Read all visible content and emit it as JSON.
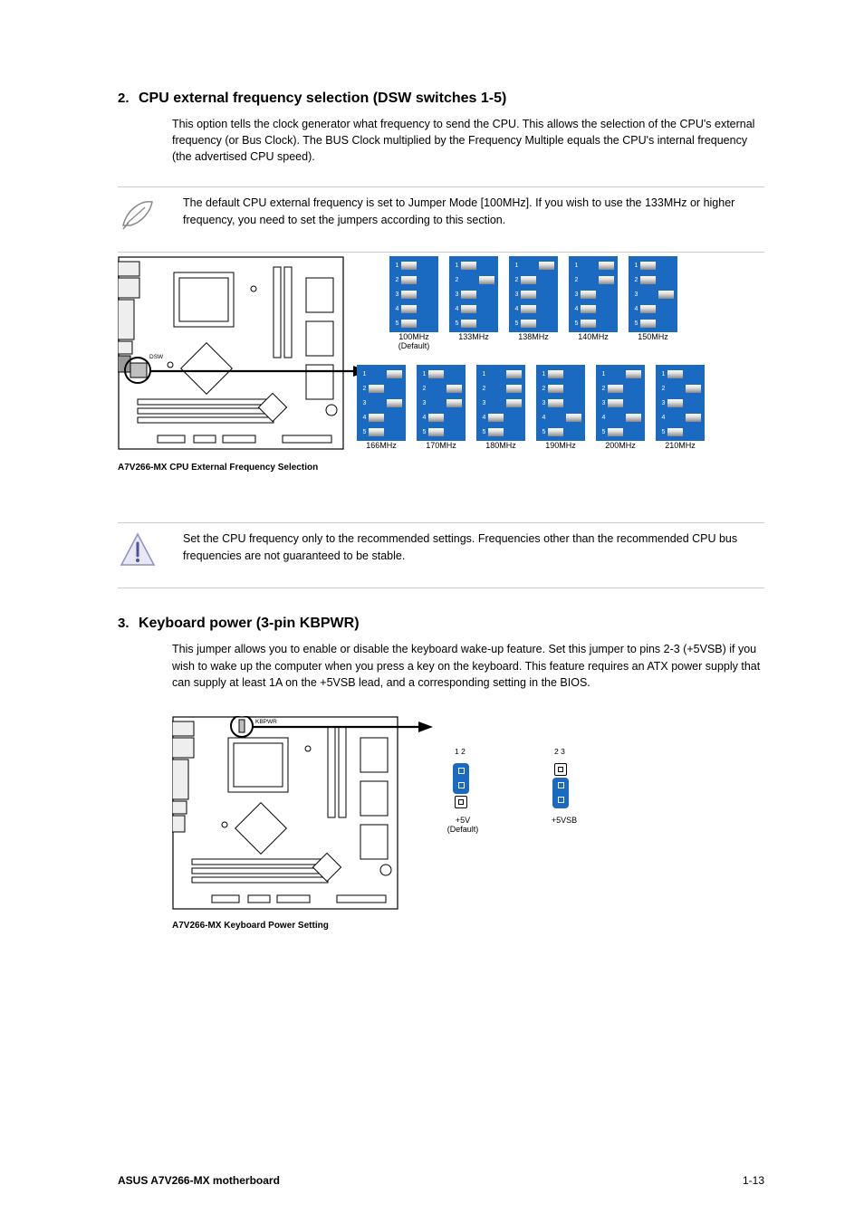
{
  "section1": {
    "num": "2.",
    "title": "CPU external frequency selection (DSW switches 1-5)",
    "para": "This option tells the clock generator what frequency to send the CPU. This allows the selection of the CPU's external frequency (or Bus Clock). The BUS Clock multiplied by the Frequency Multiple equals the CPU's internal frequency (the advertised CPU speed).",
    "note": "The default CPU external frequency is set to Jumper Mode [100MHz]. If you wish to use the 133MHz or higher frequency, you need to set the jumpers according to this section.",
    "caption": "A7V266-MX CPU External Frequency Selection",
    "port_label": "DSW",
    "caution": "Set the CPU frequency only to the recommended settings. Frequencies other than the recommended CPU bus frequencies are not guaranteed to be stable.",
    "dip_top": [
      {
        "pattern": [
          "off",
          "off",
          "off",
          "off",
          "off"
        ],
        "label": "100MHz\n(Default)"
      },
      {
        "pattern": [
          "off",
          "on",
          "off",
          "off",
          "off"
        ],
        "label": "133MHz"
      },
      {
        "pattern": [
          "on",
          "off",
          "off",
          "off",
          "off"
        ],
        "label": "138MHz"
      },
      {
        "pattern": [
          "on",
          "on",
          "off",
          "off",
          "off"
        ],
        "label": "140MHz"
      },
      {
        "pattern": [
          "off",
          "off",
          "on",
          "off",
          "off"
        ],
        "label": "150MHz"
      }
    ],
    "dip_bot": [
      {
        "pattern": [
          "on",
          "off",
          "on",
          "off",
          "off"
        ],
        "label": "166MHz"
      },
      {
        "pattern": [
          "off",
          "on",
          "on",
          "off",
          "off"
        ],
        "label": "170MHz"
      },
      {
        "pattern": [
          "on",
          "on",
          "on",
          "off",
          "off"
        ],
        "label": "180MHz"
      },
      {
        "pattern": [
          "off",
          "off",
          "off",
          "on",
          "off"
        ],
        "label": "190MHz"
      },
      {
        "pattern": [
          "on",
          "off",
          "off",
          "on",
          "off"
        ],
        "label": "200MHz"
      },
      {
        "pattern": [
          "off",
          "on",
          "off",
          "on",
          "off"
        ],
        "label": "210MHz"
      }
    ]
  },
  "section2": {
    "num": "3.",
    "title": "Keyboard power (3-pin KBPWR)",
    "para1": "This jumper allows you to enable or disable the keyboard wake-up feature. Set this jumper to pins 2-3 (+5VSB) if you wish to wake up the computer when you press a key on the keyboard. This feature requires an ATX power supply that can supply at least 1A on the +5VSB lead, and a corresponding setting in the BIOS.",
    "caption": "A7V266-MX Keyboard Power Setting",
    "port_label": "KBPWR",
    "opt1_label": "+5V\n(Default)",
    "opt2_label": "+5VSB",
    "pins1": "1 2",
    "pins2": "2 3"
  },
  "footer": {
    "left": "ASUS A7V266-MX motherboard",
    "right": "1-13"
  }
}
